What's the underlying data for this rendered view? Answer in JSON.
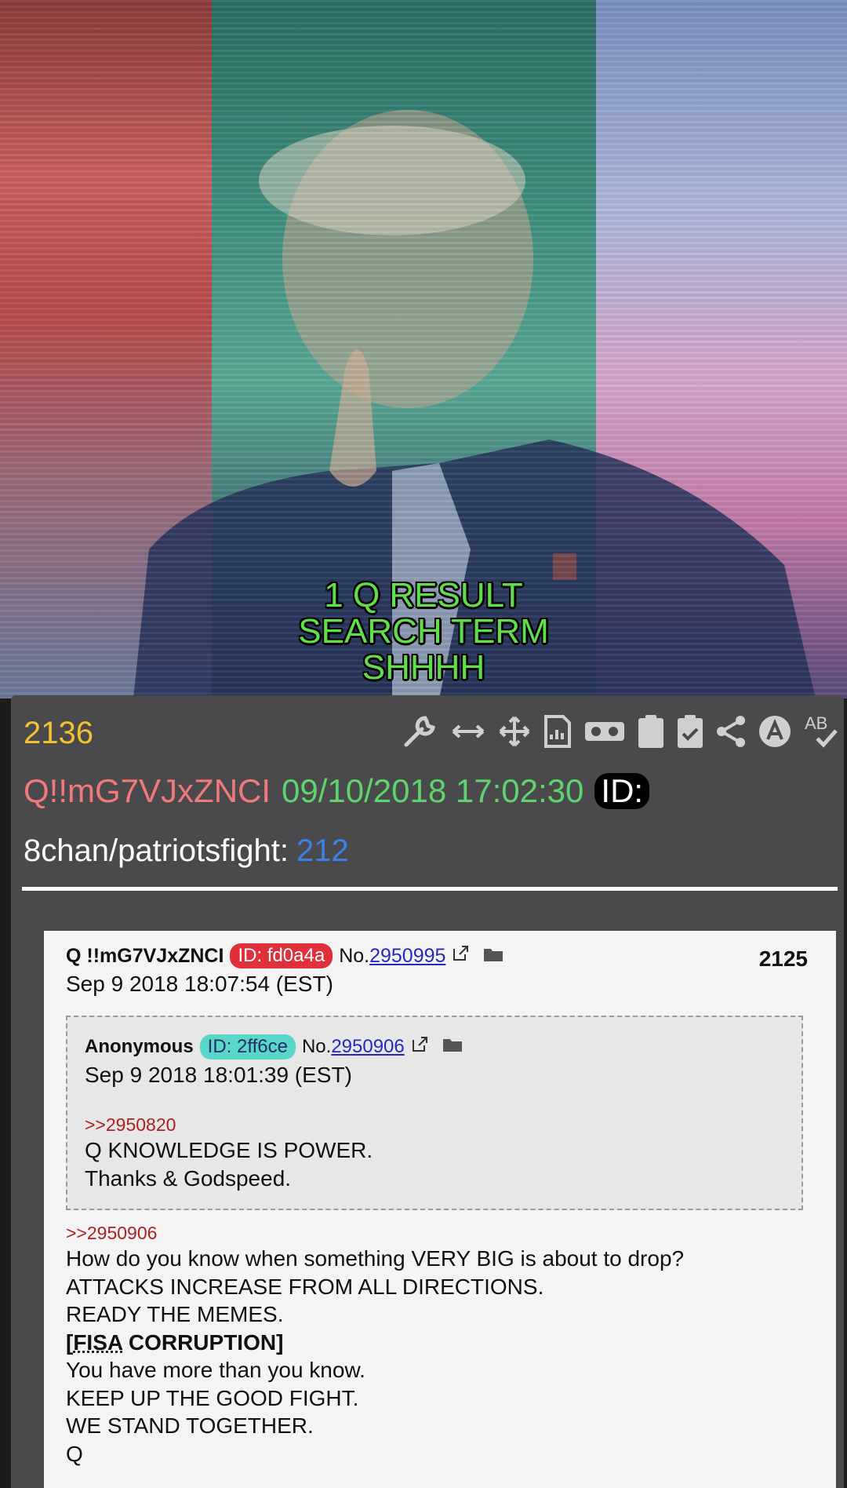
{
  "caption": {
    "line1": "1 Q RESULT",
    "line2": "SEARCH TERM",
    "line3": "SHHHH"
  },
  "post": {
    "number": "2136",
    "tripcode": "Q!!mG7VJxZNCI",
    "datetime": "09/10/2018 17:02:30",
    "id_label": "ID:",
    "source": "8chan/patriotsfight:",
    "source_count": "212",
    "toolbar_icons": [
      "wrench-icon",
      "expand-horizontal-icon",
      "move-icon",
      "document-chart-icon",
      "vr-goggles-icon",
      "clipboard-icon",
      "clipboard-check-icon",
      "share-icon",
      "a-circle-icon",
      "ab-check-icon"
    ]
  },
  "screenshot": {
    "author": "Q !!mG7VJxZNCI",
    "id": "ID: fd0a4a",
    "no_prefix": "No.",
    "post_no": "2950995",
    "timestamp": "Sep 9 2018 18:07:54 (EST)",
    "count": "2125",
    "reply": {
      "author": "Anonymous",
      "id": "ID: 2ff6ce",
      "no_prefix": "No.",
      "post_no": "2950906",
      "timestamp": "Sep 9 2018 18:01:39 (EST)",
      "quote": ">>2950820",
      "line1": "Q KNOWLEDGE IS POWER.",
      "line2": "Thanks & Godspeed."
    },
    "quote": ">>2950906",
    "lines": {
      "l1": "How do you know when something VERY BIG is about to drop?",
      "l2": "ATTACKS INCREASE FROM ALL DIRECTIONS.",
      "l3": "READY THE MEMES.",
      "l4_open": "[",
      "l4_fisa": "FISA",
      "l4_rest": " CORRUPTION]",
      "l5": "You have more than you know.",
      "l6": "KEEP UP THE GOOD FIGHT.",
      "l7": "WE STAND TOGETHER.",
      "l8": "Q"
    }
  },
  "colors": {
    "post_number": "#f2c230",
    "tripcode": "#f07a7a",
    "datetime": "#5fd46d",
    "source_count": "#3b82e6",
    "caption": "#5fe04a"
  }
}
